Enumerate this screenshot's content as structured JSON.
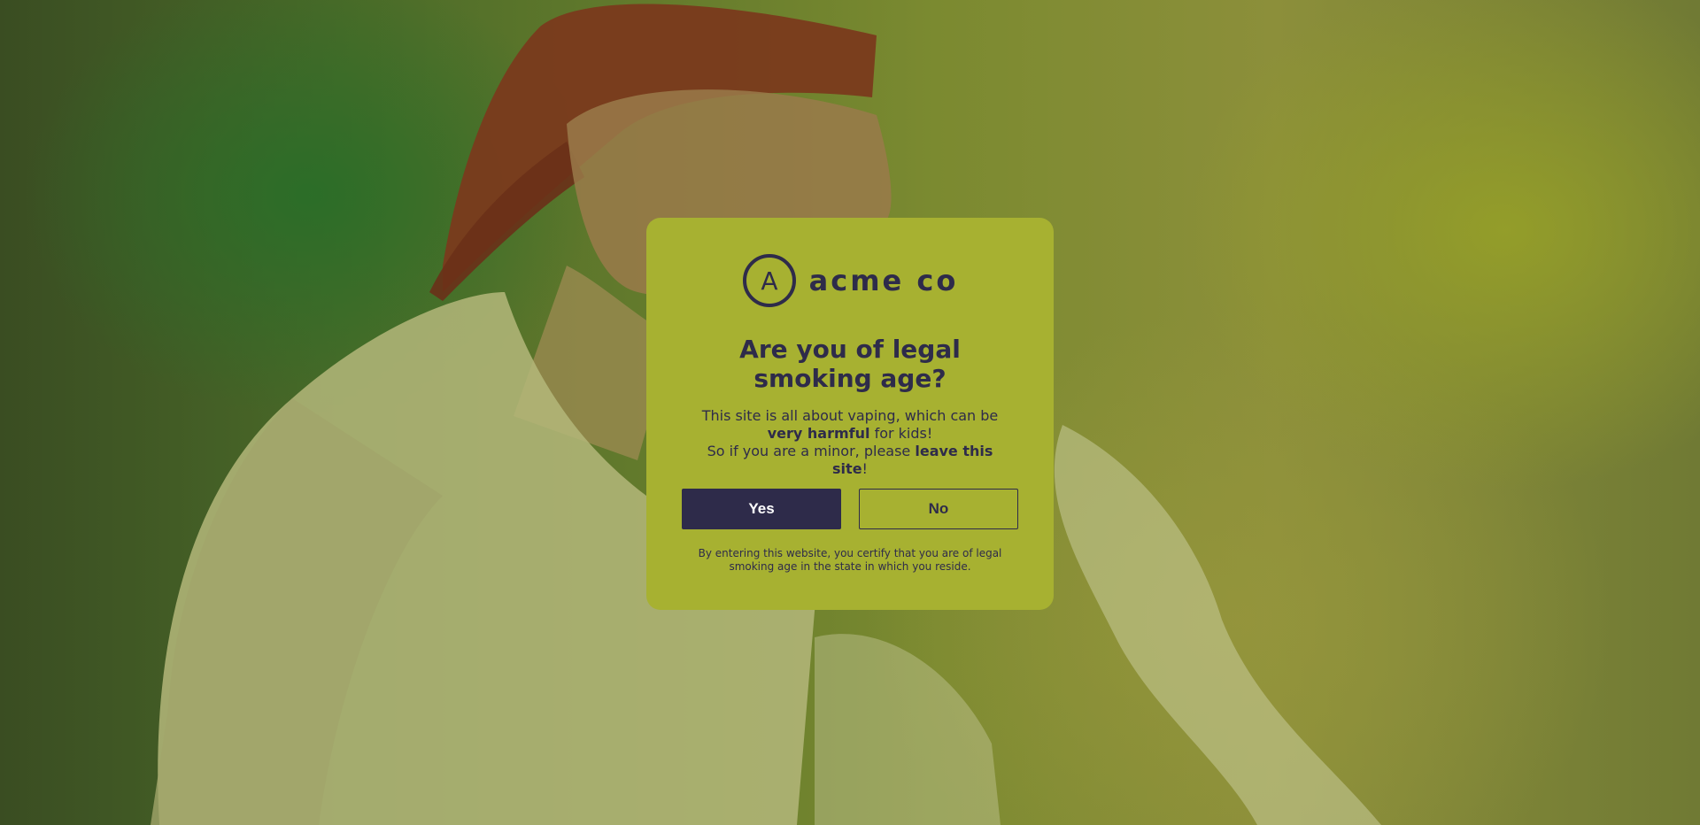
{
  "brand": {
    "logo_letter": "A",
    "name": "acme co",
    "logo_icon": "acme-circle-logo"
  },
  "age_gate": {
    "heading": "Are you of legal smoking age?",
    "body_line1_pre": "This site is all about vaping, which can be ",
    "body_line1_bold": "very harmful",
    "body_line1_post": " for kids!",
    "body_line2_pre": "So if you are a minor, please ",
    "body_line2_bold": "leave this site",
    "body_line2_post": "!",
    "yes_label": "Yes",
    "no_label": "No",
    "fine_print": "By entering this website, you certify that you are of legal smoking age in the state in which you reside."
  },
  "colors": {
    "modal_background": "#a7b131",
    "primary_dark": "#2e2b4a",
    "button_text_light": "#ffffff"
  }
}
